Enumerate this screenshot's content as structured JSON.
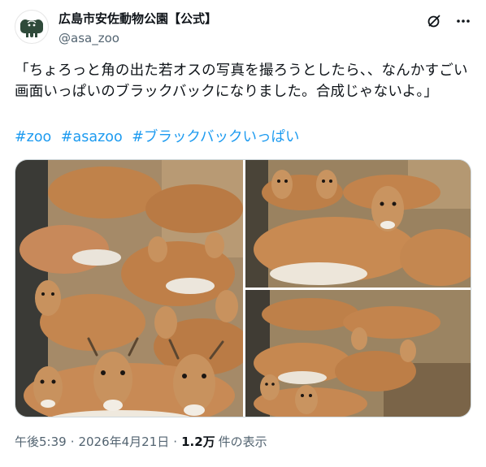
{
  "account": {
    "display_name": "広島市安佐動物公園【公式】",
    "handle": "@asa_zoo",
    "avatar_icon": "elephant-logo-icon"
  },
  "header_icons": {
    "grok": "grok-icon",
    "more": "more-icon"
  },
  "tweet": {
    "text": "「ちょろっと角の出た若オスの写真を撮ろうとしたら、、なんかすごい画面いっぱいのブラックバックになりました。合成じゃないよ。」",
    "hashtags": [
      "#zoo",
      "#asazoo",
      "#ブラックバックいっぱい"
    ]
  },
  "media": {
    "photo_count": 3,
    "photos": [
      "blackbuck-herd-photo-1",
      "blackbuck-herd-photo-2",
      "blackbuck-herd-photo-3"
    ]
  },
  "meta": {
    "time": "午後5:39",
    "separator": "·",
    "date": "2026年4月21日",
    "views_count": "1.2万",
    "views_label": "件の表示"
  },
  "colors": {
    "link": "#1d9bf0",
    "secondary_text": "#536471",
    "primary_text": "#0f1419",
    "border": "#cfd9de"
  }
}
